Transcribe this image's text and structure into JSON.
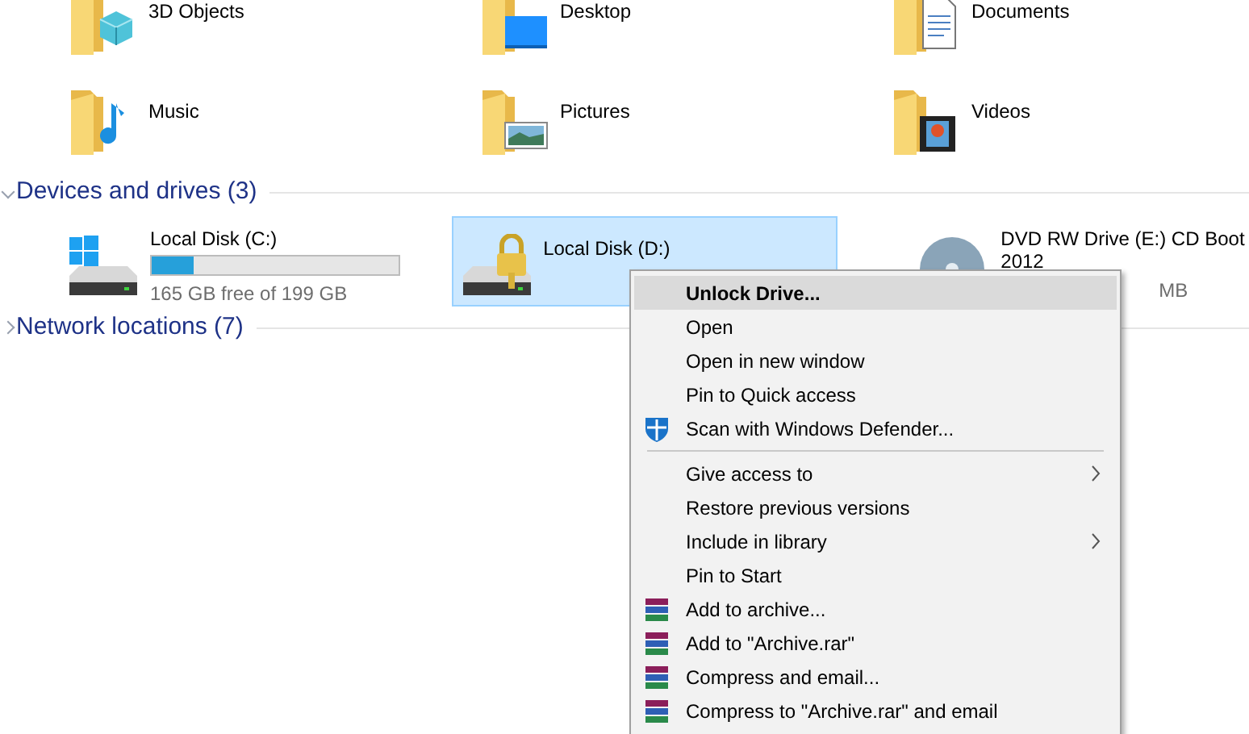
{
  "folders": [
    {
      "name": "3D Objects",
      "kind": "objects"
    },
    {
      "name": "Desktop",
      "kind": "desktop"
    },
    {
      "name": "Documents",
      "kind": "documents"
    },
    {
      "name": "Music",
      "kind": "music"
    },
    {
      "name": "Pictures",
      "kind": "pictures"
    },
    {
      "name": "Videos",
      "kind": "videos"
    }
  ],
  "devices": {
    "title": "Devices and drives (3)",
    "expanded": true,
    "drives": [
      {
        "name": "Local Disk (C:)",
        "kind": "system",
        "selected": false,
        "level": 0.17,
        "free": "165 GB free of 199 GB"
      },
      {
        "name": "Local Disk (D:)",
        "kind": "locked",
        "selected": true
      },
      {
        "name": "DVD RW Drive (E:) CD Boot 2012",
        "kind": "disc",
        "selected": false,
        "free": "MB"
      }
    ]
  },
  "network": {
    "title": "Network locations (7)"
  },
  "context_menu": {
    "items": [
      {
        "kind": "item",
        "label": "Unlock Drive...",
        "selected": true,
        "bold": true
      },
      {
        "kind": "item",
        "label": "Open",
        "selected": false
      },
      {
        "kind": "item",
        "label": "Open in new window",
        "selected": false
      },
      {
        "kind": "item",
        "label": "Pin to Quick access",
        "selected": false
      },
      {
        "kind": "shield",
        "label": "Scan with Windows Defender...",
        "selected": false
      },
      {
        "kind": "separator"
      },
      {
        "kind": "item",
        "label": "Give access to",
        "selected": false,
        "submenu": true
      },
      {
        "kind": "item",
        "label": "Restore previous versions",
        "selected": false
      },
      {
        "kind": "item",
        "label": "Include in library",
        "selected": false,
        "submenu": true
      },
      {
        "kind": "item",
        "label": "Pin to Start",
        "selected": false
      },
      {
        "kind": "archive",
        "label": "Add to archive...",
        "selected": false
      },
      {
        "kind": "archive",
        "label": "Add to \"Archive.rar\"",
        "selected": false
      },
      {
        "kind": "archive",
        "label": "Compress and email...",
        "selected": false
      },
      {
        "kind": "archive",
        "label": "Compress to \"Archive.rar\" and email",
        "selected": false
      }
    ]
  }
}
